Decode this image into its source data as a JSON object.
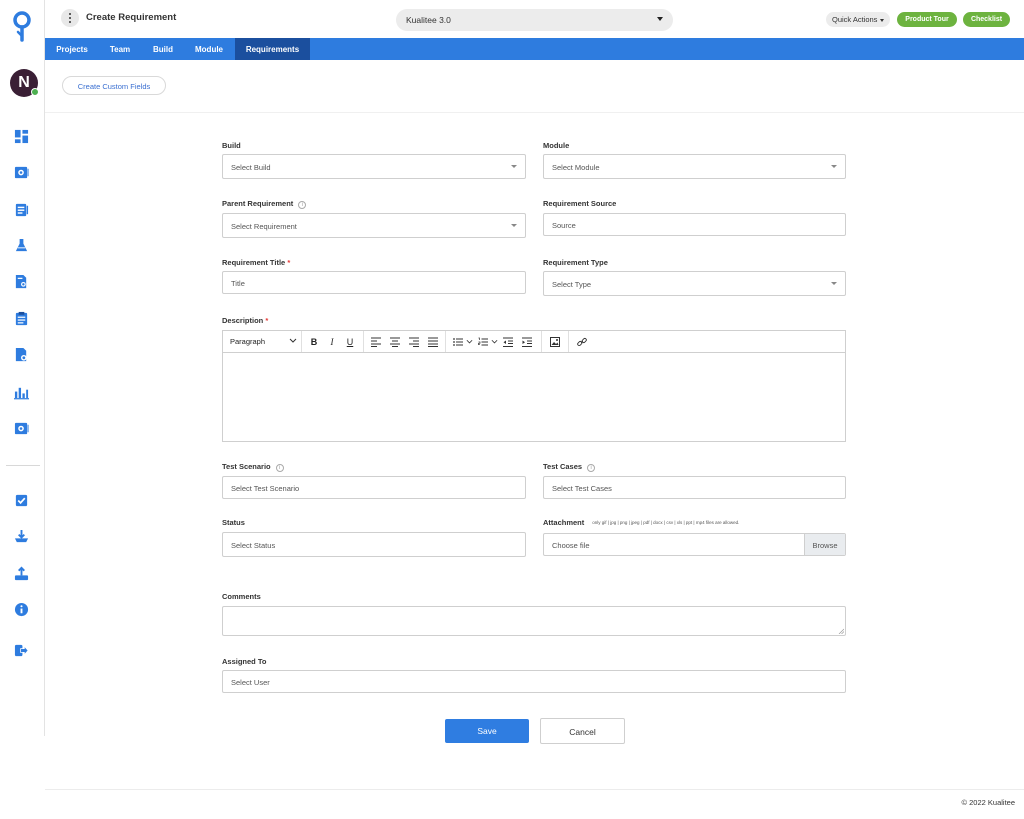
{
  "header": {
    "page_title": "Create Requirement",
    "project": "Kualitee 3.0",
    "quick_actions": "Quick Actions",
    "product_tour": "Product Tour",
    "checklist": "Checklist",
    "accent_green": "#6db33f"
  },
  "user": {
    "initial": "N",
    "status": "online"
  },
  "sidebar": {
    "icons": [
      "dashboard-icon",
      "settings-folder-icon",
      "test-cases-icon",
      "flask-icon",
      "document-search-icon",
      "clipboard-icon",
      "document-settings-icon",
      "reports-chart-icon",
      "integrations-icon",
      "task-check-icon",
      "download-icon",
      "upload-icon",
      "info-icon",
      "logout-icon"
    ]
  },
  "nav": {
    "tabs": [
      "Projects",
      "Team",
      "Build",
      "Module",
      "Requirements"
    ],
    "active": "Requirements",
    "color": "#2e7cdf",
    "active_color": "#1b4f9e"
  },
  "create_custom_fields": "Create Custom Fields",
  "form": {
    "build": {
      "label": "Build",
      "placeholder": "Select Build"
    },
    "module": {
      "label": "Module",
      "placeholder": "Select Module"
    },
    "parent_requirement": {
      "label": "Parent Requirement",
      "placeholder": "Select Requirement"
    },
    "requirement_source": {
      "label": "Requirement Source",
      "placeholder": "Source"
    },
    "requirement_title": {
      "label": "Requirement Title",
      "required": "*",
      "placeholder": "Title"
    },
    "requirement_type": {
      "label": "Requirement Type",
      "placeholder": "Select Type"
    },
    "description": {
      "label": "Description",
      "required": "*",
      "paragraph": "Paragraph"
    },
    "test_scenario": {
      "label": "Test Scenario",
      "placeholder": "Select Test Scenario"
    },
    "test_cases": {
      "label": "Test Cases",
      "placeholder": "Select Test Cases"
    },
    "status": {
      "label": "Status",
      "placeholder": "Select Status"
    },
    "attachment": {
      "label": "Attachment",
      "note": "only gif | jpg | png | jpeg | pdf | docx | csv | xls | ppt | mp4 files are allowed.",
      "placeholder": "Choose file",
      "browse": "Browse"
    },
    "comments": {
      "label": "Comments"
    },
    "assigned_to": {
      "label": "Assigned To",
      "placeholder": "Select User"
    }
  },
  "actions": {
    "save": "Save",
    "cancel": "Cancel",
    "primary_color": "#2f7de1"
  },
  "footer": {
    "copyright": "© 2022 Kualitee"
  }
}
